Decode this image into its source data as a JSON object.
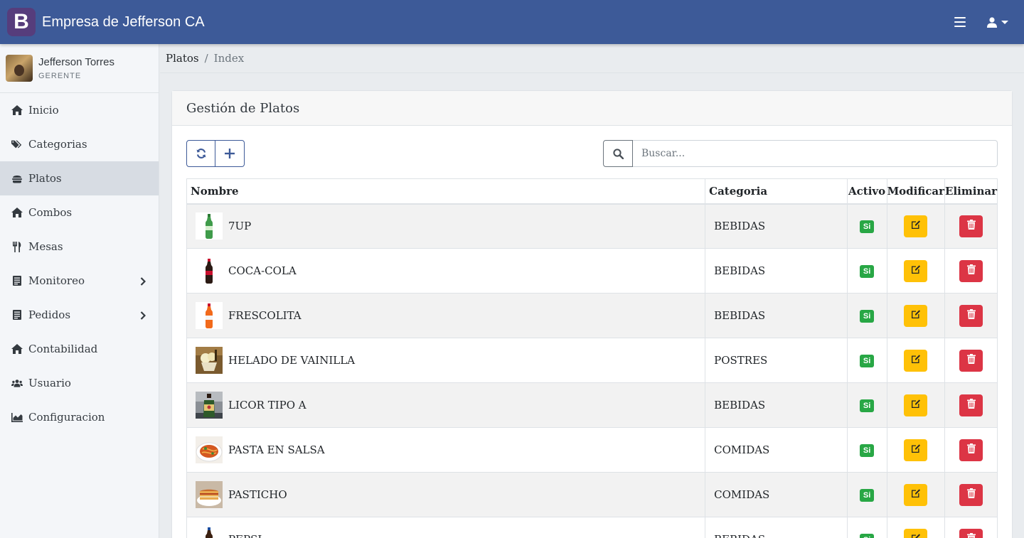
{
  "app": {
    "brand_letter": "B",
    "title": "Empresa de Jefferson CA"
  },
  "user": {
    "name": "Jefferson Torres",
    "role": "GERENTE"
  },
  "sidebar": {
    "items": [
      {
        "label": "Inicio",
        "icon": "home-icon"
      },
      {
        "label": "Categorias",
        "icon": "tags-icon"
      },
      {
        "label": "Platos",
        "icon": "burger-icon",
        "active": true
      },
      {
        "label": "Combos",
        "icon": "home-icon"
      },
      {
        "label": "Mesas",
        "icon": "utensils-icon"
      },
      {
        "label": "Monitoreo",
        "icon": "list-icon",
        "has_submenu": true
      },
      {
        "label": "Pedidos",
        "icon": "list-icon",
        "has_submenu": true
      },
      {
        "label": "Contabilidad",
        "icon": "home-icon"
      },
      {
        "label": "Usuario",
        "icon": "users-icon"
      },
      {
        "label": "Configuracion",
        "icon": "chart-icon"
      }
    ]
  },
  "breadcrumb": {
    "parent": "Platos",
    "separator": "/",
    "current": "Index"
  },
  "card": {
    "title": "Gestión de Platos"
  },
  "search": {
    "placeholder": "Buscar..."
  },
  "table": {
    "headers": {
      "name": "Nombre",
      "category": "Categoria",
      "active": "Activo",
      "edit": "Modificar",
      "delete": "Eliminar"
    },
    "rows": [
      {
        "name": "7UP",
        "category": "BEBIDAS",
        "active": "Si",
        "thumb": "green-bottle"
      },
      {
        "name": "COCA-COLA",
        "category": "BEBIDAS",
        "active": "Si",
        "thumb": "dark-bottle"
      },
      {
        "name": "FRESCOLITA",
        "category": "BEBIDAS",
        "active": "Si",
        "thumb": "orange-bottle"
      },
      {
        "name": "HELADO DE VAINILLA",
        "category": "POSTRES",
        "active": "Si",
        "thumb": "ice-cream"
      },
      {
        "name": "LICOR TIPO A",
        "category": "BEBIDAS",
        "active": "Si",
        "thumb": "liquor"
      },
      {
        "name": "PASTA EN SALSA",
        "category": "COMIDAS",
        "active": "Si",
        "thumb": "pasta"
      },
      {
        "name": "PASTICHO",
        "category": "COMIDAS",
        "active": "Si",
        "thumb": "lasagna"
      },
      {
        "name": "PEPSI",
        "category": "BEBIDAS",
        "active": "Si",
        "thumb": "pepsi-bottle"
      }
    ]
  },
  "colors": {
    "navbar": "#3d5a98",
    "active_badge": "#28a745",
    "edit": "#ffc107",
    "delete": "#dc3545"
  }
}
